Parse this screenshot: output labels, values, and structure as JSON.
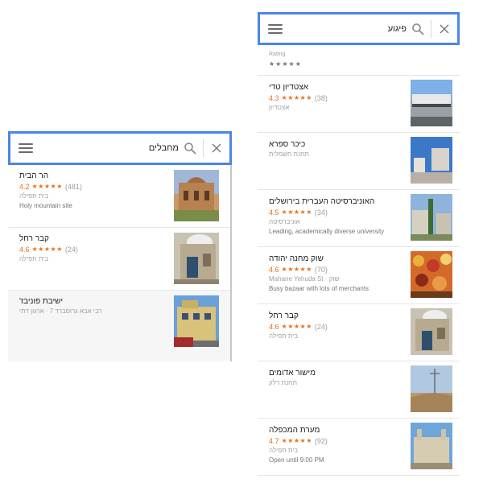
{
  "left_panel": {
    "search": {
      "query": "מחבלים"
    },
    "results": [
      {
        "name": "הר הבית",
        "rating": "4.2",
        "stars": "★★★★★",
        "count": "(481)",
        "category": "בית תפילה",
        "description": "Holy mountain site"
      },
      {
        "name": "קבר רחל",
        "rating": "4.6",
        "stars": "★★★★★",
        "count": "(24)",
        "category": "בית תפילה"
      },
      {
        "name": "ישיבת פוניבז'",
        "address": "רבי אבא גרוסברד 7 · ארגון דתי"
      }
    ]
  },
  "right_panel": {
    "search": {
      "query": "פיגוע"
    },
    "filter": {
      "label": "Rating",
      "stars": "★★★★★"
    },
    "results": [
      {
        "name": "אצטדיון טדי",
        "rating": "4.3",
        "stars": "★★★★★",
        "count": "(38)",
        "category": "אצטדיון"
      },
      {
        "name": "כיכר ספרא",
        "category": "תחנת חשמלית"
      },
      {
        "name": "האוניברסיטה העברית בירושלים",
        "rating": "4.5",
        "stars": "★★★★★",
        "count": "(34)",
        "category": "אוניברסיטה",
        "description": "Leading, academically diverse university"
      },
      {
        "name": "שוק מחנה יהודה",
        "rating": "4.6",
        "stars": "★★★★★",
        "count": "(70)",
        "category": "שוק · Mahane Yehuda St",
        "description": "Busy bazaar with lots of merchants"
      },
      {
        "name": "קבר רחל",
        "rating": "4.6",
        "stars": "★★★★★",
        "count": "(24)",
        "category": "בית תפילה"
      },
      {
        "name": "מישור אדומים",
        "category": "תחנת דלק"
      },
      {
        "name": "מערת המכפלה",
        "rating": "4.7",
        "stars": "★★★★★",
        "count": "(92)",
        "category": "בית תפילה",
        "description": "Open until 9:00 PM"
      }
    ]
  },
  "colors": {
    "search_border": "#4a87e6",
    "rating": "#e7711b",
    "secondary_text": "#9aa0a6"
  },
  "icons": [
    "menu-icon",
    "search-icon",
    "close-icon",
    "star-icon"
  ]
}
